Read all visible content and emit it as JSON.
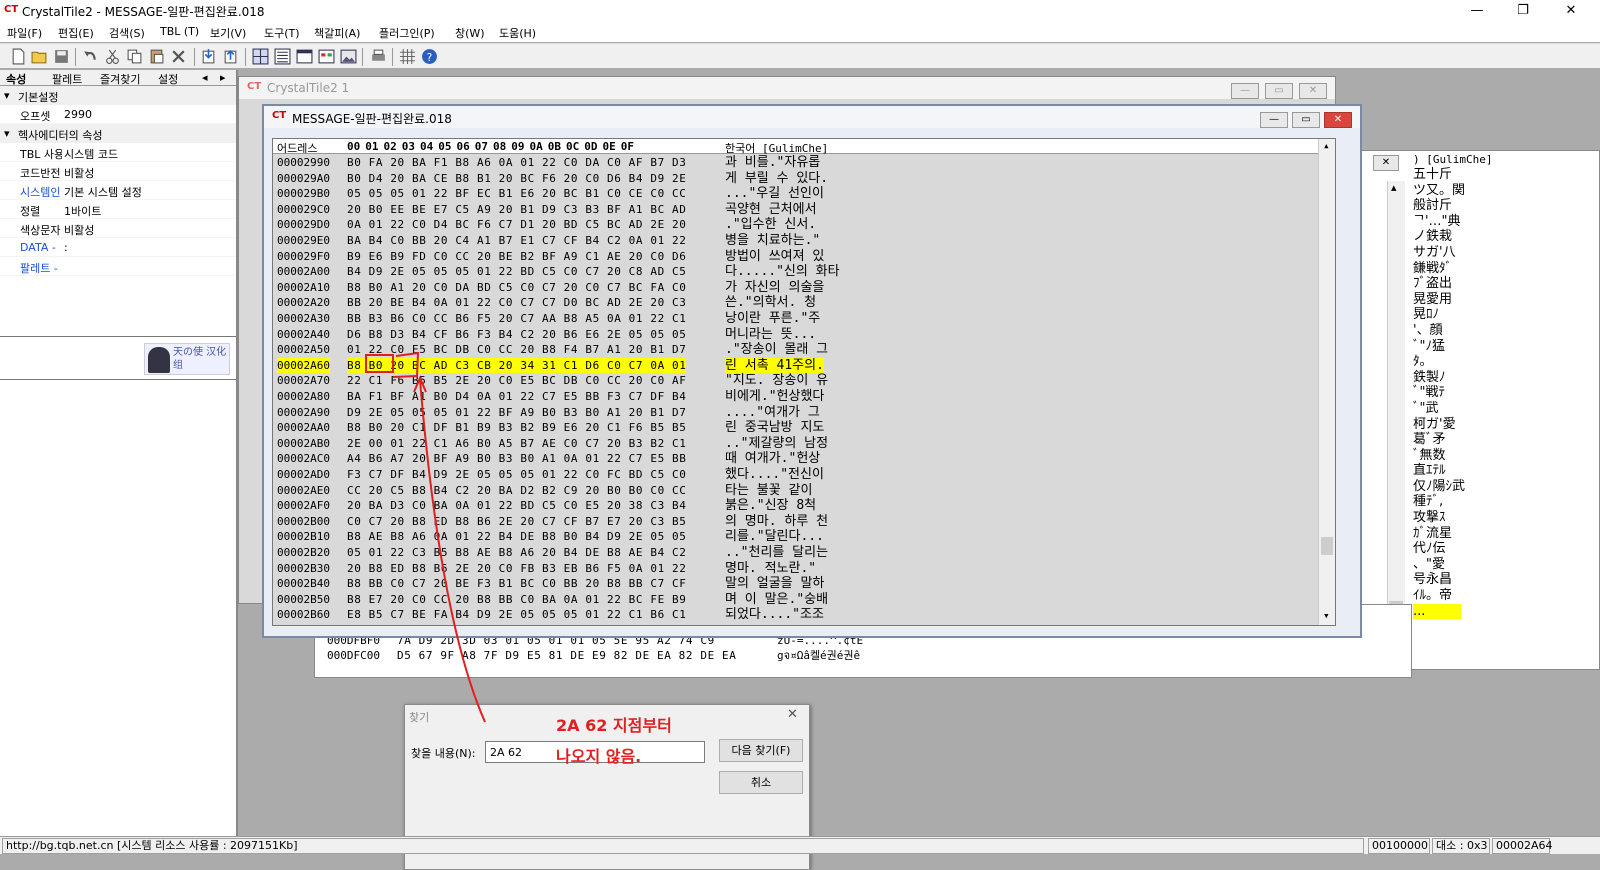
{
  "app": {
    "title": "CrystalTile2 - MESSAGE-일판-편집완료.018",
    "logo_text": "CT"
  },
  "window_controls": {
    "minimize": "—",
    "maximize": "❐",
    "close": "✕"
  },
  "menu": [
    "파일(F)",
    "편집(E)",
    "검색(S)",
    "TBL (T)",
    "보기(V)",
    "도구(T)",
    "책갈피(A)",
    "플러그인(P)",
    "창(W)",
    "도움(H)"
  ],
  "toolbar_icons": [
    "new-file-icon",
    "open-folder-icon",
    "save-icon",
    "undo-icon",
    "cut-icon",
    "copy-icon",
    "paste-icon",
    "delete-icon",
    "import-icon",
    "export-icon",
    "tile-view-icon",
    "hex-view-icon",
    "text-view-icon",
    "palette-icon",
    "image-icon",
    "print-icon",
    "grid-icon",
    "help-icon"
  ],
  "left_panel": {
    "tabs": [
      "속성",
      "팔레트",
      "즐겨찾기",
      "설정"
    ],
    "groups": [
      {
        "label": "기본설정",
        "rows": [
          {
            "label": "오프셋",
            "value": "2990"
          }
        ]
      },
      {
        "label": "헥사에디터의 속성",
        "rows": [
          {
            "label": "TBL 사용",
            "value": "시스템 코드"
          },
          {
            "label": "코드반전",
            "value": "비활성"
          },
          {
            "label": "시스템인",
            "value": "기본 시스템 설정"
          },
          {
            "label": "정렬",
            "value": "1바이트"
          },
          {
            "label": "색상문자",
            "value": "비활성"
          },
          {
            "label": "DATA -",
            "value": ":"
          },
          {
            "label": "팔레트 -",
            "value": ""
          }
        ]
      }
    ],
    "logo_text": "天の使 汉化组"
  },
  "windows": {
    "back1_title": "CrystalTile2 1",
    "main_title": "MESSAGE-일판-편집완료.018"
  },
  "hex": {
    "header_addr": "어드레스",
    "header_cols": [
      "00",
      "01",
      "02",
      "03",
      "04",
      "05",
      "06",
      "07",
      "08",
      "09",
      "0A",
      "0B",
      "0C",
      "0D",
      "0E",
      "0F"
    ],
    "header_text": "한국어 [GulimChe]",
    "rows": [
      {
        "addr": "00002990",
        "bytes": "B0 FA 20 BA F1 B8 A6 0A 01 22 C0 DA C0 AF B7 D3",
        "text": "과 비를.\"자유롭"
      },
      {
        "addr": "000029A0",
        "bytes": "B0 D4 20 BA CE B8 B1 20 BC F6 20 C0 D6 B4 D9 2E",
        "text": "게 부릴 수 있다."
      },
      {
        "addr": "000029B0",
        "bytes": "05 05 05 01 22 BF EC B1 E6 20 BC B1 C0 CE C0 CC",
        "text": "...\"우길 선인이"
      },
      {
        "addr": "000029C0",
        "bytes": "20 B0 EE BE E7 C5 A9 20 B1 D9 C3 B3 BF A1 BC AD",
        "text": " 곡양현 근처에서"
      },
      {
        "addr": "000029D0",
        "bytes": "0A 01 22 C0 D4 BC F6 C7 D1 20 BD C5 BC AD 2E 20",
        "text": ".\"입수한 신서. "
      },
      {
        "addr": "000029E0",
        "bytes": "BA B4 C0 BB 20 C4 A1 B7 E1 C7 CF B4 C2 0A 01 22",
        "text": "병을 치료하는.\""
      },
      {
        "addr": "000029F0",
        "bytes": "B9 E6 B9 FD C0 CC 20 BE B2 BF A9 C1 AE 20 C0 D6",
        "text": "방법이 쓰여져 있"
      },
      {
        "addr": "00002A00",
        "bytes": "B4 D9 2E 05 05 05 01 22 BD C5 C0 C7 20 C8 AD C5",
        "text": "다.....\"신의 화타"
      },
      {
        "addr": "00002A10",
        "bytes": "B8 B0 A1 20 C0 DA BD C5 C0 C7 20 C0 C7 BC FA C0",
        "text": " 가 자신의 의술을"
      },
      {
        "addr": "00002A20",
        "bytes": "BB 20 BE B4 0A 01 22 C0 C7 C7 D0 BC AD 2E 20 C3",
        "text": " 쓴.\"의학서. 청"
      },
      {
        "addr": "00002A30",
        "bytes": "BB B3 B6 C0 CC B6 F5 20 C7 AA B8 A5 0A 01 22 C1",
        "text": " 낭이란 푸른.\"주"
      },
      {
        "addr": "00002A40",
        "bytes": "D6 B8 D3 B4 CF B6 F3 B4 C2 20 B6 E6 2E 05 05 05",
        "text": " 머니라는 뜻..."
      },
      {
        "addr": "00002A50",
        "bytes": "01 22 C0 E5 BC DB C0 CC 20 B8 F4 B7 A1 20 B1 D7",
        "text": ".\"장송이 몰래 그"
      },
      {
        "addr": "00002A60",
        "bytes": "B8 B0 20 BC AD C3 CB 20 34 31 C1 D6 C0 C7 0A 01",
        "text": "린 서촉 41주의.",
        "hl": true
      },
      {
        "addr": "00002A70",
        "bytes": "22 C1 F6 B5 B5 2E 20 C0 E5 BC DB C0 CC 20 C0 AF",
        "text": "\"지도. 장송이 유"
      },
      {
        "addr": "00002A80",
        "bytes": "BA F1 BF A1 B0 D4 0A 01 22 C7 E5 BB F3 C7 DF B4",
        "text": "비에게.\"헌상했다"
      },
      {
        "addr": "00002A90",
        "bytes": "D9 2E 05 05 05 01 22 BF A9 B0 B3 B0 A1 20 B1 D7",
        "text": "....\"여개가 그"
      },
      {
        "addr": "00002AA0",
        "bytes": "B8 B0 20 C1 DF B1 B9 B3 B2 B9 E6 20 C1 F6 B5 B5",
        "text": "린 중국남방 지도"
      },
      {
        "addr": "00002AB0",
        "bytes": "2E 00 01 22 C1 A6 B0 A5 B7 AE C0 C7 20 B3 B2 C1",
        "text": "..\"제갈량의 남정"
      },
      {
        "addr": "00002AC0",
        "bytes": "A4 B6 A7 20 BF A9 B0 B3 B0 A1 0A 01 22 C7 E5 BB",
        "text": "  때 여개가.\"헌상"
      },
      {
        "addr": "00002AD0",
        "bytes": "F3 C7 DF B4 D9 2E 05 05 05 01 22 C0 FC BD C5 C0",
        "text": " 했다....\"전신이"
      },
      {
        "addr": "00002AE0",
        "bytes": "CC 20 C5 B8 B4 C2 20 BA D2 B2 C9 20 B0 B0 C0 CC",
        "text": " 타는 불꽃 같이"
      },
      {
        "addr": "00002AF0",
        "bytes": "20 BA D3 C0 BA 0A 01 22 BD C5 C0 E5 20 38 C3 B4",
        "text": " 붉은.\"신장 8척"
      },
      {
        "addr": "00002B00",
        "bytes": "C0 C7 20 B8 ED B8 B6 2E 20 C7 CF B7 E7 20 C3 B5",
        "text": "의 명마. 하루 천"
      },
      {
        "addr": "00002B10",
        "bytes": "B8 AE B8 A6 0A 01 22 B4 DE B8 B0 B4 D9 2E 05 05",
        "text": "리를.\"달린다..."
      },
      {
        "addr": "00002B20",
        "bytes": "05 01 22 C3 B5 B8 AE B8 A6 20 B4 DE B8 AE B4 C2",
        "text": "..\"천리를 달리는"
      },
      {
        "addr": "00002B30",
        "bytes": "20 B8 ED B8 B6 2E 20 C0 FB B3 EB B6 F5 0A 01 22",
        "text": " 명마. 적노란.\""
      },
      {
        "addr": "00002B40",
        "bytes": "B8 BB C0 C7 20 BE F3 B1 BC C0 BB 20 B8 BB C7 CF",
        "text": "말의 얼굴을 말하"
      },
      {
        "addr": "00002B50",
        "bytes": "B8 E7 20 C0 CC 20 B8 BB C0 BA 0A 01 22 BC FE B9",
        "text": "며 이 말은.\"숭배"
      },
      {
        "addr": "00002B60",
        "bytes": "E8 B5 C7 BE FA B4 D9 2E 05 05 05 01 22 C1 B6 C1",
        "text": " 되었다....\"조조"
      }
    ]
  },
  "back_window_bottom": {
    "rows": [
      {
        "addr": "000DFBF0",
        "bytes": "7A D9 2D 3D 03 01 05 01 01 05 5E 95 A2 74 C9",
        "text": "zÙ-=....^.¢tÉ"
      },
      {
        "addr": "000DFC00",
        "bytes": "D5 67 9F A8 7F D9 E5 81 DE E9 82 DE EA 82 DE EA",
        "text": "gจ¤Ωâ켈é권é권ê"
      }
    ]
  },
  "right_window": {
    "header": ") [GulimChe]",
    "lines": [
      "五十斤",
      "ツ又。関",
      "般討斤",
      "ᄀ'…\"典",
      "ノ鉄栽",
      "サガ'八",
      "鎌戦ﾀﾞ",
      "ﾌﾞ盗出",
      "晃愛用",
      "晃ﾛﾉ",
      "'、顔",
      "ﾞ\"ﾉ猛",
      "ﾀ。",
      "鉄製ﾉ",
      "ﾞ\"戦ﾃ",
      "ﾞ\"武",
      "柯ガ'愛",
      "葛ﾞ矛",
      "ﾞ無数",
      "直ｴﾃﾙ",
      "仅ﾉ陽ｼ武",
      "種ﾃﾞ,",
      "攻撃ｽ",
      "ｶﾞ流星",
      "代ﾉ伝",
      "、\"愛",
      "号永昌",
      "ｲﾙ。帝",
      "..."
    ]
  },
  "find_dialog": {
    "title": "찾기",
    "label": "찾을 내용(N):",
    "value": "2A 62",
    "find_next": "다음 찾기(F)",
    "cancel": "취소"
  },
  "annotation": {
    "line1": "2A 62 지점부터",
    "line2": "나오지 않음."
  },
  "status": {
    "url": "http://bg.tqb.net.cn [시스템 리소스 사용률 : 2097151Kb]",
    "offset": "00100000",
    "size": "대소 : 0x3",
    "pos": "00002A64"
  }
}
